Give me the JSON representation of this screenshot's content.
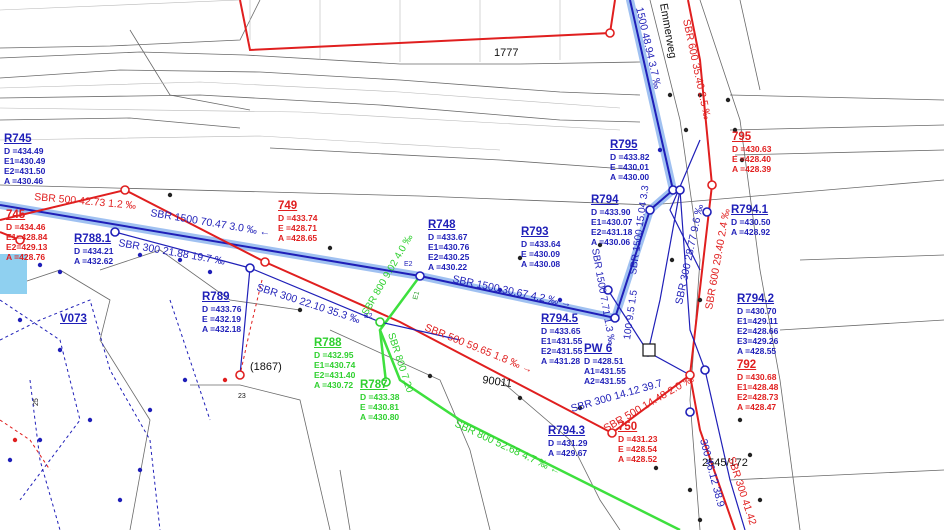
{
  "parcels": {
    "p1777": "1777",
    "p1867": "(1867)",
    "p90011": "90011",
    "p2545": "2545/172",
    "p23": "23",
    "p25": "25",
    "street": "Emmerweg",
    "e1": "E1",
    "e2_a": "E2",
    "e2_b": "E2"
  },
  "manholes": {
    "R745": {
      "title": "R745",
      "l1": "D =434.49",
      "l2": "E1=430.49",
      "l3": "E2=431.50",
      "l4": "A =430.46"
    },
    "n745": {
      "title": "745",
      "l1": "D =434.46",
      "l2": "E1=428.84",
      "l3": "E2=429.13",
      "l4": "A =428.76"
    },
    "R788_1": {
      "title": "R788.1",
      "l1": "D =434.21",
      "l2": "A =432.62"
    },
    "V073": {
      "title": "V073"
    },
    "n749": {
      "title": "749",
      "l1": "D =433.74",
      "l2": "E =428.71",
      "l3": "A =428.65"
    },
    "R748": {
      "title": "R748",
      "l1": "D =433.67",
      "l2": "E1=430.76",
      "l3": "E2=430.25",
      "l4": "A =430.22"
    },
    "R793": {
      "title": "R793",
      "l1": "D =433.64",
      "l2": "E =430.09",
      "l3": "A =430.08"
    },
    "R794": {
      "title": "R794",
      "l1": "D =433.90",
      "l2": "E1=430.07",
      "l3": "E2=431.18",
      "l4": "A =430.06"
    },
    "R795": {
      "title": "R795",
      "l1": "D =433.82",
      "l2": "E =430.01",
      "l3": "A =430.00"
    },
    "n795": {
      "title": "795",
      "l1": "D =430.63",
      "l2": "E =428.40",
      "l3": "A =428.39"
    },
    "R794_1": {
      "title": "R794.1",
      "l1": "D =430.50",
      "l2": "A =428.92"
    },
    "R794_2": {
      "title": "R794.2",
      "l1": "D =430.70",
      "l2": "E1=429.11",
      "l3": "E2=428.66",
      "l4": "E3=429.26",
      "l5": "A =428.55"
    },
    "n792": {
      "title": "792",
      "l1": "D =430.68",
      "l2": "E1=428.48",
      "l3": "E2=428.73",
      "l4": "A =428.47"
    },
    "R789": {
      "title": "R789",
      "l1": "D =433.76",
      "l2": "E =432.19",
      "l3": "A =432.18"
    },
    "R788": {
      "title": "R788",
      "l1": "D =432.95",
      "l2": "E1=430.74",
      "l3": "E2=431.40",
      "l4": "A =430.72"
    },
    "R787": {
      "title": "R787",
      "l1": "D =433.38",
      "l2": "E =430.81",
      "l3": "A =430.80"
    },
    "R794_5": {
      "title": "R794.5",
      "l1": "D =433.65",
      "l2": "E1=431.55",
      "l3": "E2=431.55",
      "l4": "A =431.28"
    },
    "PW6": {
      "title": "PW 6",
      "l1": "D =428.51",
      "l2": "A1=431.55",
      "l3": "A2=431.55"
    },
    "R794_3": {
      "title": "R794.3",
      "l1": "D =431.29",
      "l2": "A =429.67"
    },
    "n750": {
      "title": "750",
      "l1": "D =431.23",
      "l2": "E =428.54",
      "l3": "A =428.52"
    }
  },
  "pipes": {
    "blue_main": "SBR  1500  70.47  3.0 ‰  ←",
    "blue_mid": "SBR  1500  30.67  4.2 ‰  →",
    "blue_vert": "1500  48.94  3.7 ‰",
    "blue_short": "SBR  1500  15.04  3.3",
    "blue_793": "SBR 1500 7.71 1.3 ‰",
    "red_top": "SBR  500  42.73  1.2 ‰",
    "red_mid": "SBR  500  59.65  1.8 ‰  →",
    "red_vert": "SBR  600  35.40  2.5 ‰",
    "red_lower": "SBR  600  29.40  2.4 ‰",
    "red_bottom": "SBR  500  14.48  2.0 ‰",
    "red_sbr300": "SBR  300  41.42",
    "blue_300a": "SBR  300  21.88  19.7 ‰",
    "blue_300b": "SBR  300  22.10  35.3 ‰",
    "blue_300c": "SBR  300  28.77  9.6 ‰",
    "blue_300d": "SBR  300  14.12  39.7",
    "blue_300e": "300  46.12  38.9",
    "blue_100": "100  9.5  1.5",
    "green_main": "SBR  800  52.68  4.7 ‰  ←",
    "green_a": "SBR  800  9.02  4.0 ‰",
    "green_b": "SBR  800  7.20"
  },
  "colors": {
    "blue": "#1f1fb8",
    "red": "#e01f1f",
    "green": "#2fd02f",
    "highlight": "#8fb6ee",
    "parcel": "#6a6a6a",
    "map_bg": "#ffffff"
  }
}
